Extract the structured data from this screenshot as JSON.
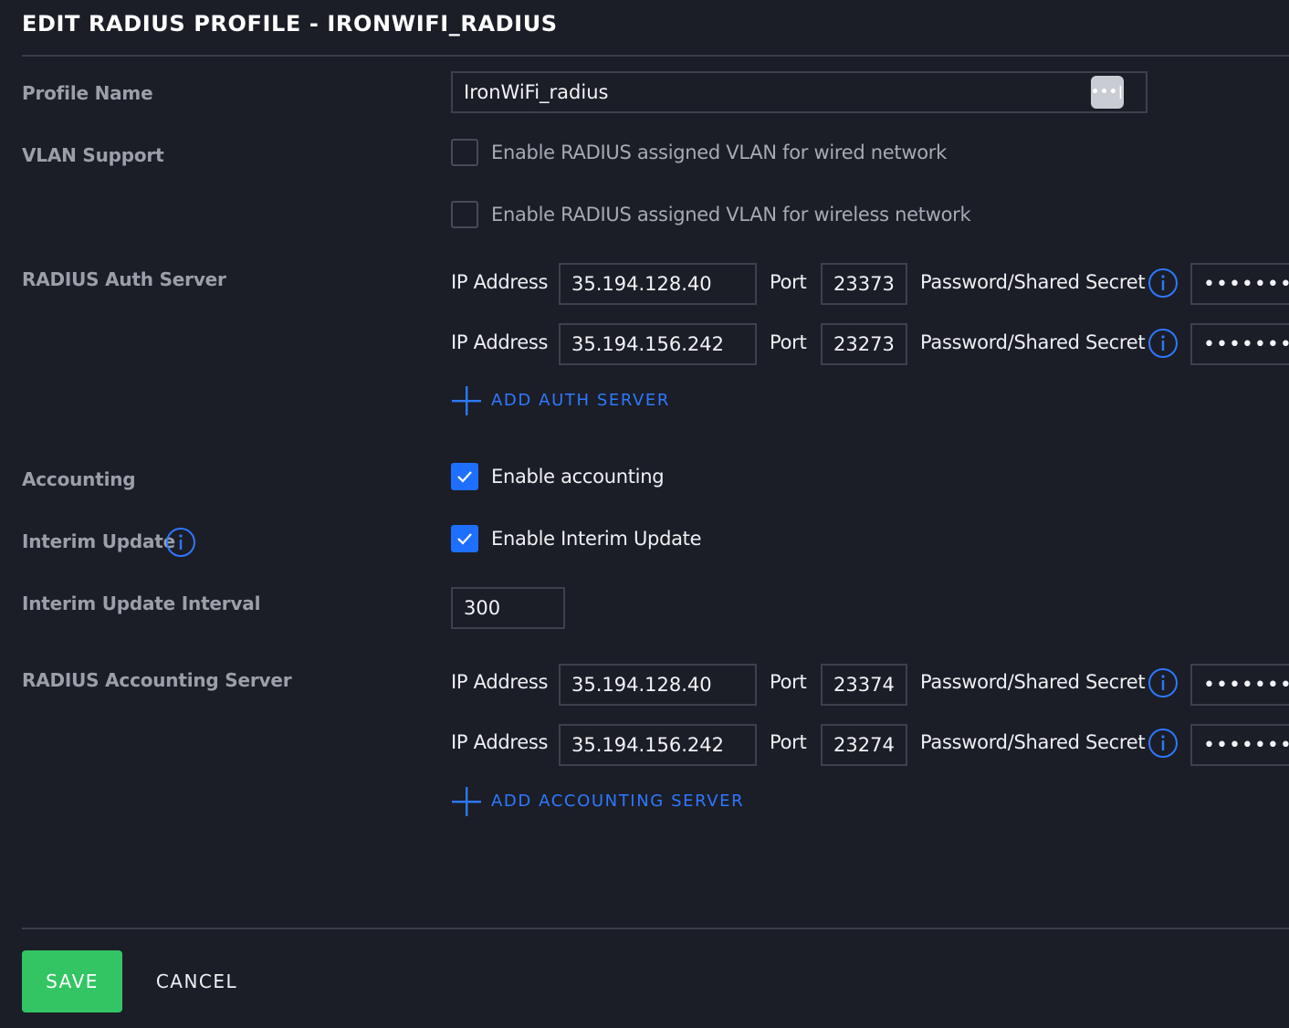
{
  "header": {
    "title": "EDIT RADIUS PROFILE - IRONWIFI_RADIUS"
  },
  "profile": {
    "label": "Profile Name",
    "value": "IronWiFi_radius",
    "action_icon": "ellipsis-icon"
  },
  "vlan": {
    "label": "VLAN Support",
    "wired": {
      "label": "Enable RADIUS assigned VLAN for wired network",
      "checked": false
    },
    "wireless": {
      "label": "Enable RADIUS assigned VLAN for wireless network",
      "checked": false
    }
  },
  "auth": {
    "label": "RADIUS Auth Server",
    "ip_label": "IP Address",
    "port_label": "Port",
    "secret_label": "Password/Shared Secret",
    "servers": [
      {
        "ip": "35.194.128.40",
        "port": "23373",
        "secret": "••••••••"
      },
      {
        "ip": "35.194.156.242",
        "port": "23273",
        "secret": "••••••••"
      }
    ],
    "add_label": "ADD AUTH SERVER"
  },
  "accounting": {
    "label": "Accounting",
    "checkbox_label": "Enable accounting",
    "checked": true
  },
  "interim": {
    "label": "Interim Update",
    "checkbox_label": "Enable Interim Update",
    "checked": true
  },
  "interval": {
    "label": "Interim Update Interval",
    "value": "300"
  },
  "acct_server": {
    "label": "RADIUS Accounting Server",
    "ip_label": "IP Address",
    "port_label": "Port",
    "secret_label": "Password/Shared Secret",
    "servers": [
      {
        "ip": "35.194.128.40",
        "port": "23374",
        "secret": "••••••••"
      },
      {
        "ip": "35.194.156.242",
        "port": "23274",
        "secret": "••••••••"
      }
    ],
    "add_label": "ADD ACCOUNTING SERVER"
  },
  "footer": {
    "save_label": "SAVE",
    "cancel_label": "CANCEL"
  },
  "colors": {
    "background": "#1b1e27",
    "accent": "#1e6fff",
    "link": "#2e78ff",
    "save": "#33c563"
  }
}
